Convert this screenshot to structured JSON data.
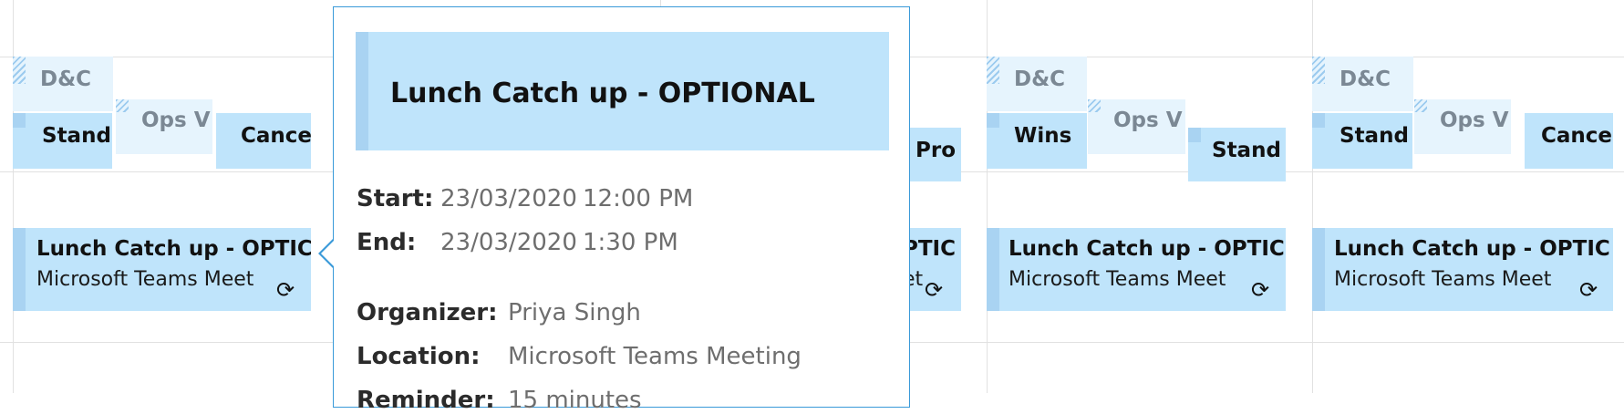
{
  "columns": [
    {
      "events": [
        {
          "label": "D&C"
        },
        {
          "label": "Stand"
        },
        {
          "label": "Ops V"
        },
        {
          "label": "Cance"
        }
      ],
      "lunch": {
        "title": "Lunch Catch up - OPTIC",
        "location": "Microsoft Teams Meet"
      }
    },
    {
      "events": [
        {
          "label": "Pro"
        }
      ],
      "lunch": {
        "title": "PTIC",
        "location": "et"
      }
    },
    {
      "events": [
        {
          "label": "D&C"
        },
        {
          "label": "Wins"
        },
        {
          "label": "Ops V"
        },
        {
          "label": "Stand"
        }
      ],
      "lunch": {
        "title": "Lunch Catch up - OPTIC",
        "location": "Microsoft Teams Meet"
      }
    },
    {
      "events": [
        {
          "label": "D&C"
        },
        {
          "label": "Stand"
        },
        {
          "label": "Ops V"
        },
        {
          "label": "Cance"
        }
      ],
      "lunch": {
        "title": "Lunch Catch up - OPTIC",
        "location": "Microsoft Teams Meet"
      }
    }
  ],
  "icons": {
    "recurrence": "recurrence-icon",
    "recurrence_glyph": "⟳"
  },
  "popup": {
    "title": "Lunch Catch up - OPTIONAL",
    "start_label": "Start:",
    "start_date": "23/03/2020",
    "start_time": "12:00 PM",
    "end_label": "End:",
    "end_date": "23/03/2020",
    "end_time": "1:30 PM",
    "organizer_label": "Organizer:",
    "organizer": "Priya Singh",
    "location_label": "Location:",
    "location": "Microsoft Teams Meeting",
    "reminder_label": "Reminder:",
    "reminder": "15 minutes"
  },
  "colors": {
    "event_busy": "#bfe4fb",
    "event_tentative": "#e6f4fd",
    "event_bar": "#a9d3f2",
    "popup_border": "#3a9ad9",
    "grid": "#e1e1e1"
  }
}
